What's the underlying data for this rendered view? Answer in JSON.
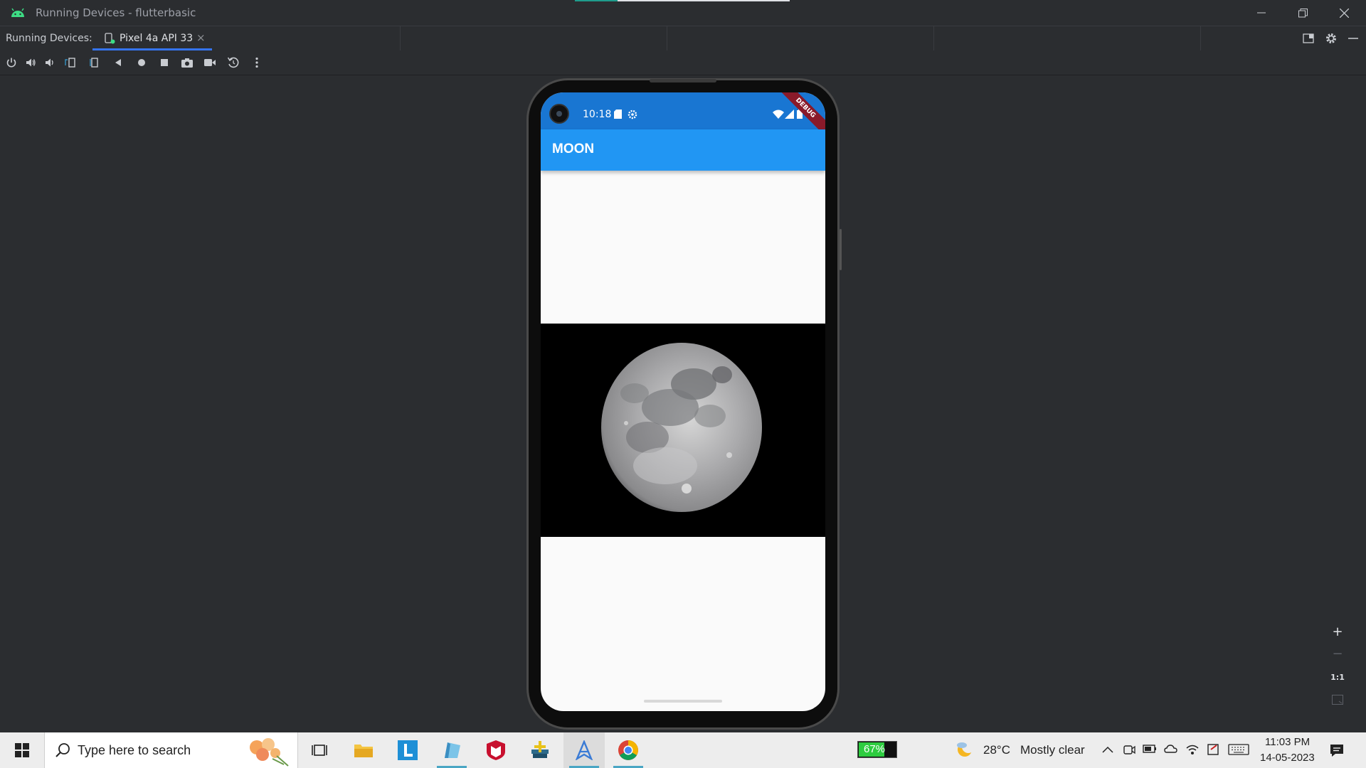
{
  "window": {
    "title": "Running Devices - flutterbasic",
    "controls": [
      "minimize",
      "restore",
      "close"
    ]
  },
  "tabbar": {
    "label": "Running Devices:",
    "tab_label": "Pixel 4a API 33",
    "tab_close": "×"
  },
  "device_toolbar": {
    "icons": [
      "power-icon",
      "volume-up-icon",
      "volume-down-icon",
      "rotate-left-icon",
      "rotate-right-icon",
      "back-icon",
      "home-icon",
      "overview-icon",
      "screenshot-icon",
      "screen-record-icon",
      "reset-icon",
      "more-icon"
    ]
  },
  "phone": {
    "status_time": "10:18",
    "app_title": "MOON",
    "debug_banner": "DEBUG"
  },
  "zoom": {
    "plus": "+",
    "minus": "−",
    "one_to_one": "1:1"
  },
  "taskbar": {
    "search_placeholder": "Type here to search",
    "battery": "67%",
    "weather_temp": "28°C",
    "weather_desc": "Mostly clear",
    "time": "11:03 PM",
    "date": "14-05-2023"
  },
  "colors": {
    "ide_bg": "#2b2d30",
    "status_bar": "#1976d2",
    "app_bar": "#2196f3",
    "tab_accent": "#3574f0",
    "battery_green": "#2ecc40"
  }
}
